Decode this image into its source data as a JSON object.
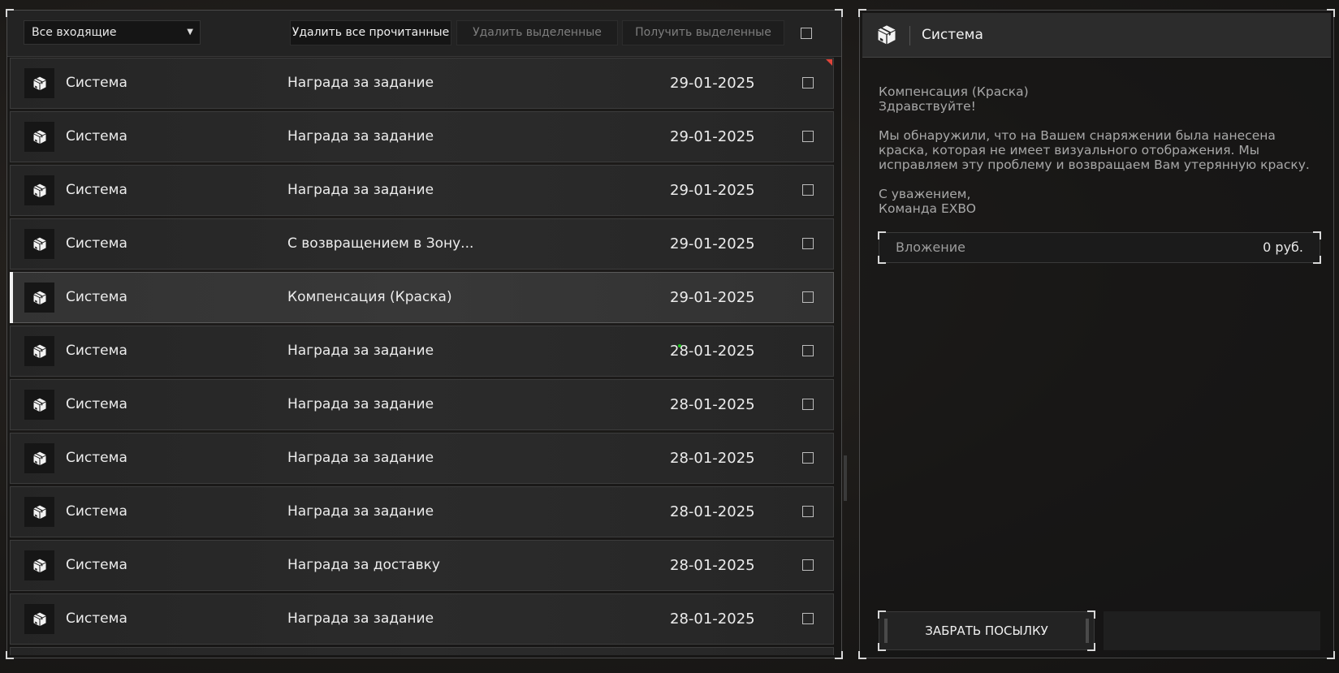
{
  "toolbar": {
    "filter_value": "Все входящие",
    "delete_read_label": "Удалить все прочитанные",
    "delete_selected_label": "Удалить выделенные",
    "get_selected_label": "Получить выделенные"
  },
  "messages": [
    {
      "sender": "Система",
      "subject": "Награда за задание",
      "date": "29-01-2025"
    },
    {
      "sender": "Система",
      "subject": "Награда за задание",
      "date": "29-01-2025"
    },
    {
      "sender": "Система",
      "subject": "Награда за задание",
      "date": "29-01-2025"
    },
    {
      "sender": "Система",
      "subject": "С возвращением в Зону...",
      "date": "29-01-2025"
    },
    {
      "sender": "Система",
      "subject": "Компенсация (Краска)",
      "date": "29-01-2025"
    },
    {
      "sender": "Система",
      "subject": "Награда за задание",
      "date": "28-01-2025"
    },
    {
      "sender": "Система",
      "subject": "Награда за задание",
      "date": "28-01-2025"
    },
    {
      "sender": "Система",
      "subject": "Награда за задание",
      "date": "28-01-2025"
    },
    {
      "sender": "Система",
      "subject": "Награда за задание",
      "date": "28-01-2025"
    },
    {
      "sender": "Система",
      "subject": "Награда за доставку",
      "date": "28-01-2025"
    },
    {
      "sender": "Система",
      "subject": "Награда за задание",
      "date": "28-01-2025"
    }
  ],
  "selected_index": 4,
  "detail": {
    "sender": "Система",
    "subject": "Компенсация (Краска)",
    "greeting": "Здравствуйте!",
    "body": "Мы обнаружили, что на Вашем снаряжении была нанесена краска, которая не имеет визуального отображения. Мы исправляем эту проблему и возвращаем Вам утерянную краску.",
    "closing": "С уважением,",
    "signature": "Команда EXBO",
    "attachment_label": "Вложение",
    "attachment_value": "0 руб.",
    "take_button_label": "ЗАБРАТЬ ПОСЫЛКУ"
  },
  "colors": {
    "accent": "#f2f2f2",
    "unread_flag": "#e0443a",
    "online_dot": "#1fc21f"
  },
  "icons": {
    "row_icon": "package-box-icon",
    "filter_arrow": "caret-down-icon"
  }
}
